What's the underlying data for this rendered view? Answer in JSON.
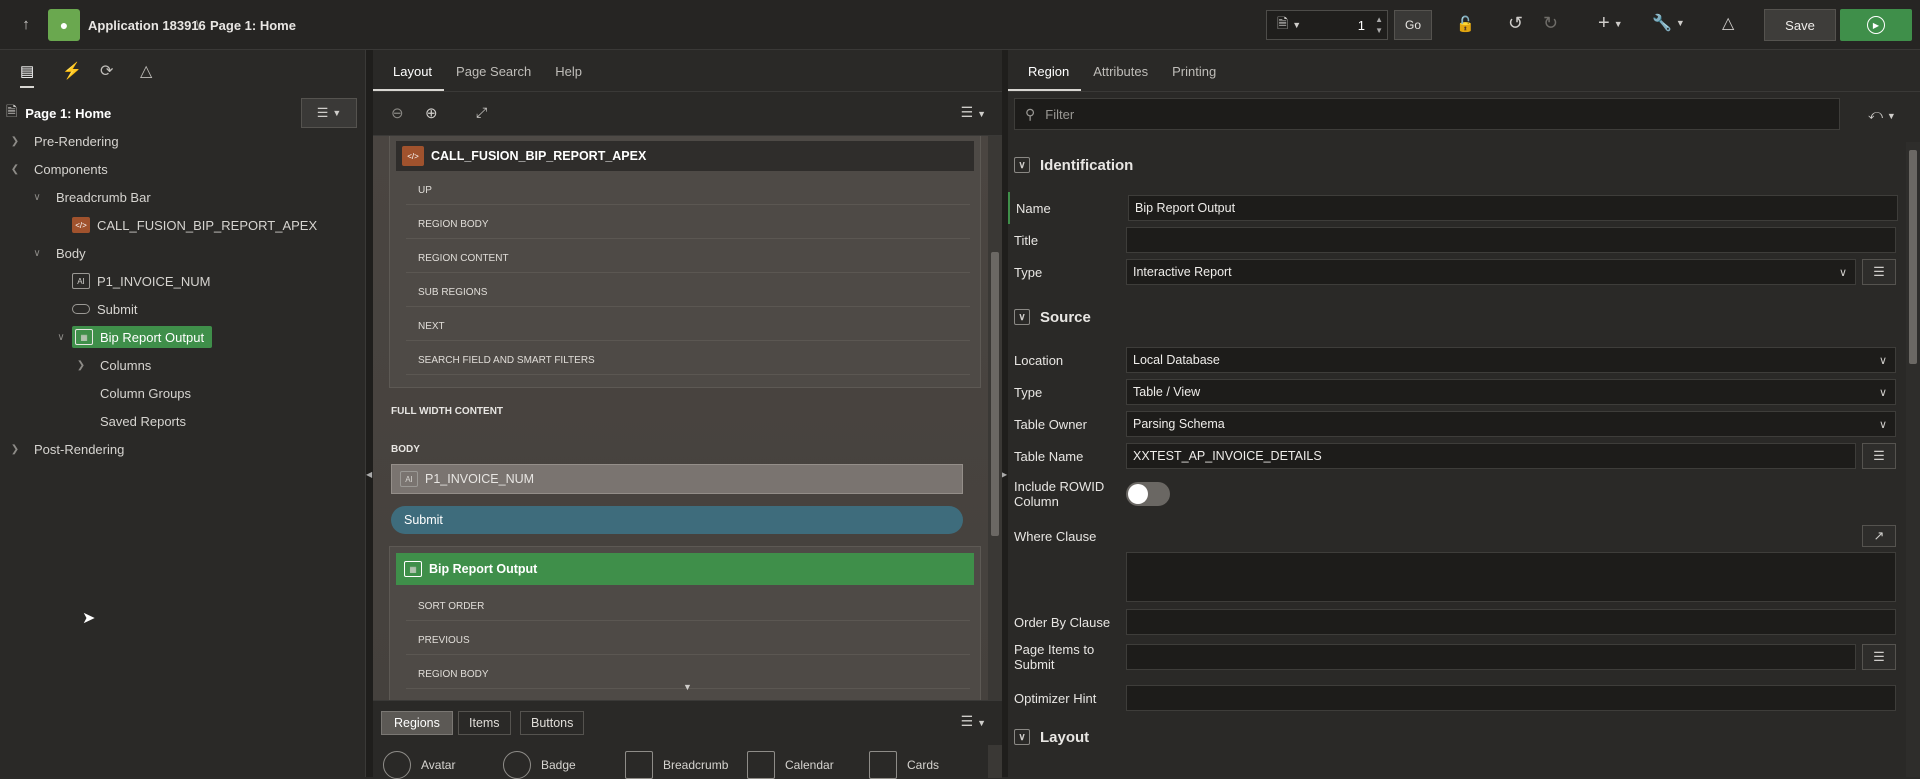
{
  "topbar": {
    "app_name": "Application 183916",
    "separator": "\\",
    "page_name": "Page 1: Home",
    "page_number": "1",
    "go_label": "Go",
    "save_label": "Save"
  },
  "left": {
    "page_title": "Page 1: Home",
    "tree": {
      "pre_rendering": "Pre-Rendering",
      "components": "Components",
      "breadcrumb_bar": "Breadcrumb Bar",
      "call_fusion": "CALL_FUSION_BIP_REPORT_APEX",
      "body": "Body",
      "p1_invoice": "P1_INVOICE_NUM",
      "submit": "Submit",
      "bip_report": "Bip Report Output",
      "columns": "Columns",
      "column_groups": "Column Groups",
      "saved_reports": "Saved Reports",
      "post_rendering": "Post-Rendering"
    }
  },
  "middle": {
    "tabs": [
      "Layout",
      "Page Search",
      "Help"
    ],
    "region_title": "CALL_FUSION_BIP_REPORT_APEX",
    "slots": [
      "UP",
      "REGION BODY",
      "REGION CONTENT",
      "SUB REGIONS",
      "NEXT",
      "SEARCH FIELD AND SMART FILTERS"
    ],
    "full_width": "FULL WIDTH CONTENT",
    "body_label": "BODY",
    "p1_item": "P1_INVOICE_NUM",
    "submit_button": "Submit",
    "bip_title": "Bip Report Output",
    "bip_slots": [
      "SORT ORDER",
      "PREVIOUS",
      "REGION BODY"
    ],
    "gallery_tabs": [
      "Regions",
      "Items",
      "Buttons"
    ],
    "gallery_items": [
      "Avatar",
      "Badge",
      "Breadcrumb",
      "Calendar",
      "Cards"
    ]
  },
  "right": {
    "tabs": [
      "Region",
      "Attributes",
      "Printing"
    ],
    "filter_placeholder": "Filter",
    "identification": "Identification",
    "name_label": "Name",
    "name_value": "Bip Report Output",
    "title_label": "Title",
    "type_label": "Type",
    "type_value": "Interactive Report",
    "source": "Source",
    "location_label": "Location",
    "location_value": "Local Database",
    "src_type_label": "Type",
    "src_type_value": "Table / View",
    "table_owner_label": "Table Owner",
    "table_owner_value": "Parsing Schema",
    "table_name_label": "Table Name",
    "table_name_value": "XXTEST_AP_INVOICE_DETAILS",
    "rowid_label": "Include ROWID Column",
    "where_label": "Where Clause",
    "order_label": "Order By Clause",
    "page_items_label": "Page Items to Submit",
    "optimizer_label": "Optimizer Hint",
    "layout": "Layout"
  }
}
